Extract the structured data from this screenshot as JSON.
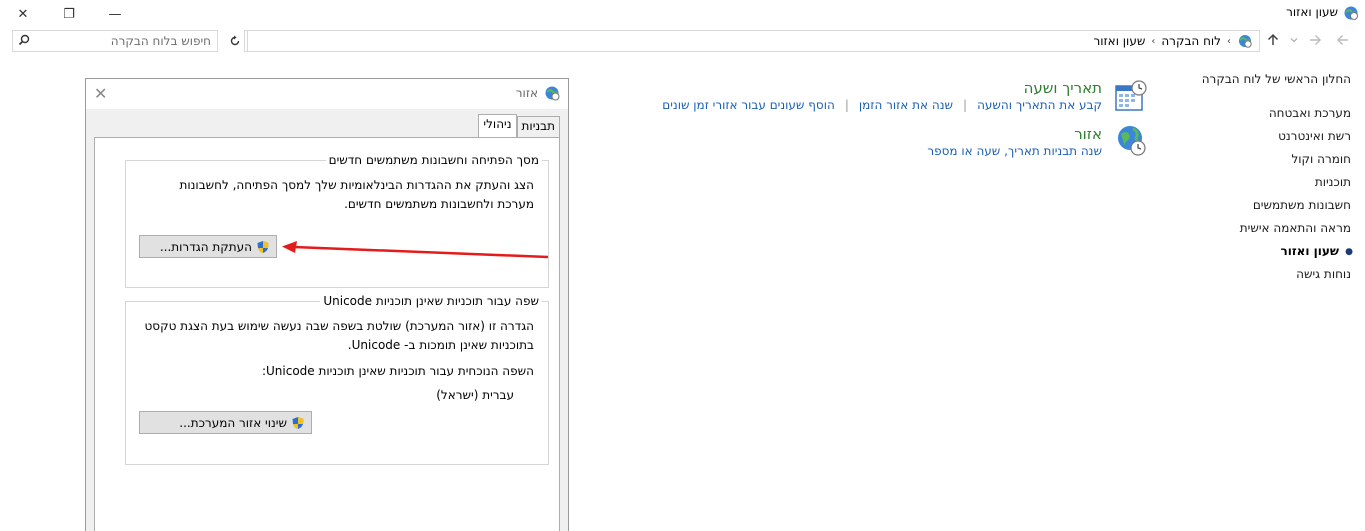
{
  "window": {
    "title": "שעון ואזור",
    "minimize_glyph": "—",
    "restore_glyph": "❐",
    "close_glyph": "✕"
  },
  "address": {
    "search_placeholder": "חיפוש בלוח הבקרה",
    "crumb_root": "לוח הבקרה",
    "crumb_current": "שעון ואזור"
  },
  "sidebar": {
    "home": "החלון הראשי של לוח הבקרה",
    "items": [
      "מערכת ואבטחה",
      "רשת ואינטרנט",
      "חומרה וקול",
      "תוכניות",
      "חשבונות משתמשים",
      "מראה והתאמה אישית",
      "שעון ואזור",
      "נוחות גישה"
    ]
  },
  "categories": {
    "datetime": {
      "title": "תאריך ושעה",
      "links": [
        "קבע את התאריך והשעה",
        "שנה את אזור הזמן",
        "הוסף שעונים עבור אזורי זמן שונים"
      ]
    },
    "region": {
      "title": "אזור",
      "links": [
        "שנה תבניות תאריך, שעה או מספר"
      ]
    }
  },
  "dialog": {
    "title": "אזור",
    "tabs": [
      "תבניות",
      "ניהולי"
    ],
    "welcome_group": {
      "legend": "מסך הפתיחה וחשבונות משתמשים חדשים",
      "text_line1": "הצג והעתק את ההגדרות הבינלאומיות שלך למסך הפתיחה, לחשבונות",
      "text_line2": "מערכת ולחשבונות משתמשים חדשים.",
      "button": "העתקת הגדרות..."
    },
    "unicode_group": {
      "legend": "שפה עבור תוכניות שאינן תוכניות Unicode",
      "text_line1": "הגדרה זו (אזור המערכת) שולטת בשפה שבה נעשה שימוש בעת הצגת טקסט",
      "text_line2": "בתוכניות שאינן תומכות ב- Unicode.",
      "current_label": "השפה הנוכחית עבור תוכניות שאינן תוכניות Unicode:",
      "current_value": "עברית (ישראל)",
      "button": "שינוי אזור המערכת..."
    }
  },
  "colors": {
    "link": "#1a5fb4",
    "category_title": "#2f7d2f",
    "annotation_arrow": "#e31b1b"
  }
}
